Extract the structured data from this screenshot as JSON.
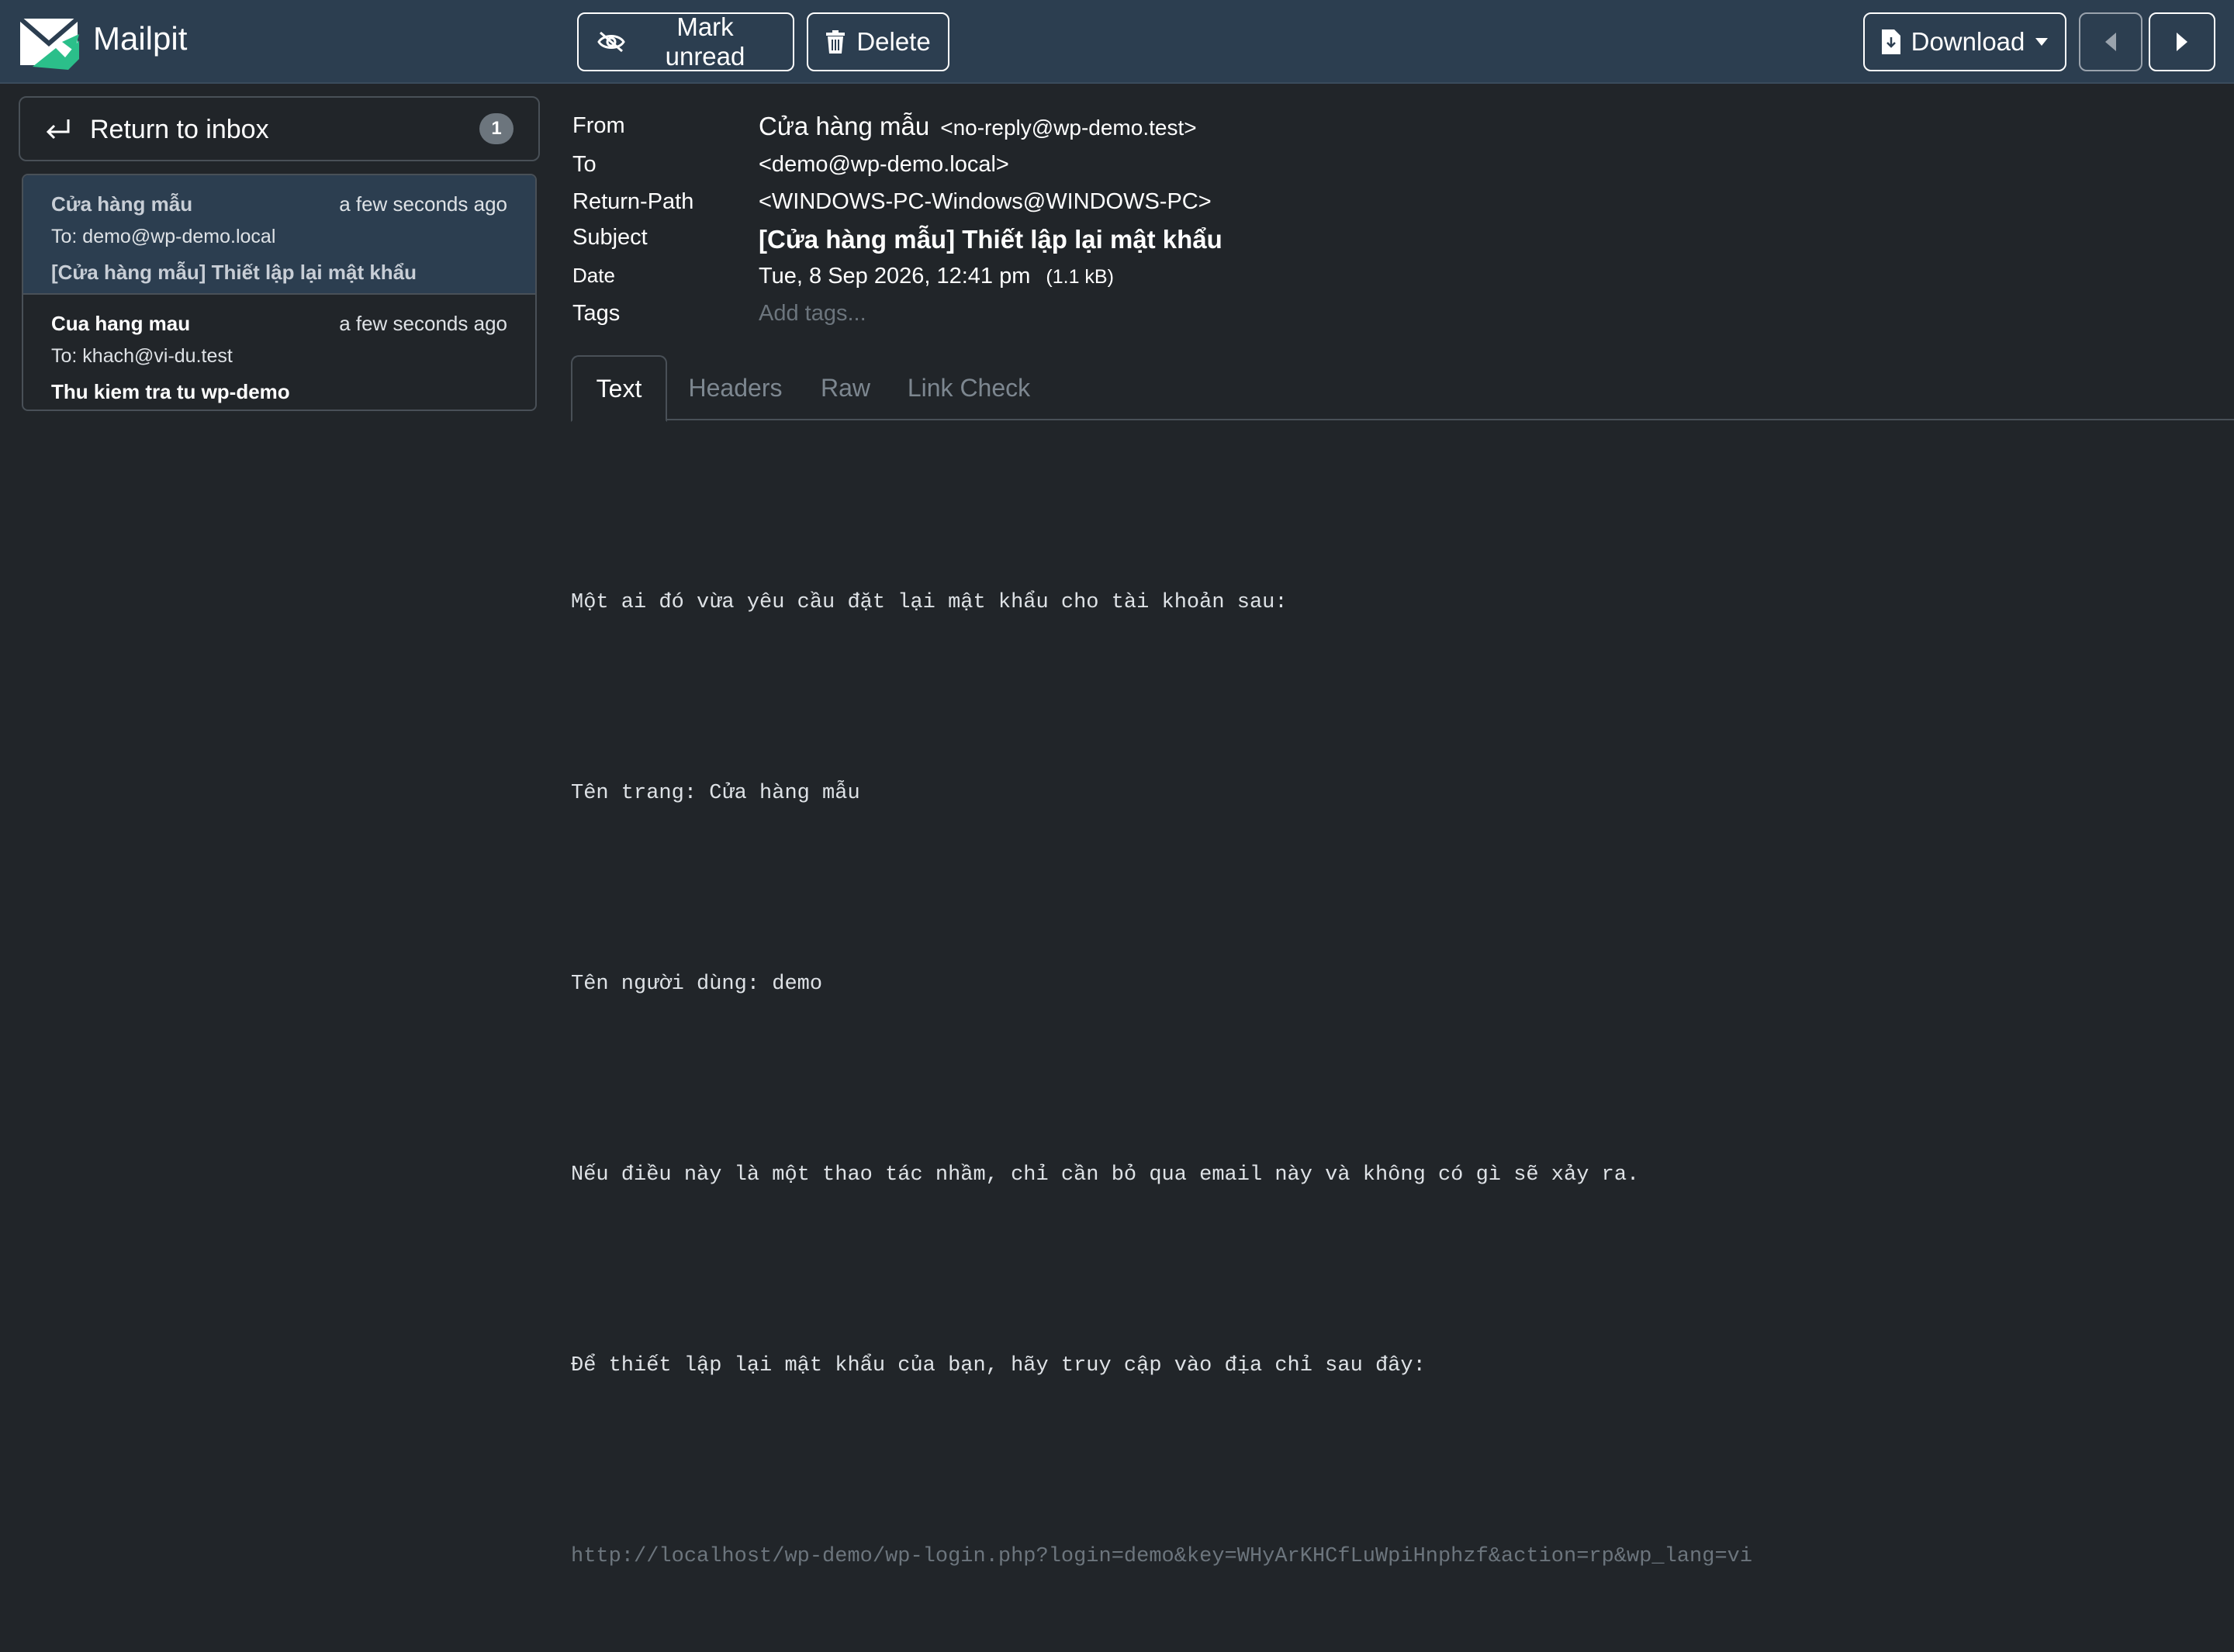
{
  "app": {
    "name": "Mailpit"
  },
  "toolbar": {
    "mark_unread": "Mark unread",
    "delete": "Delete",
    "download": "Download"
  },
  "sidebar": {
    "return_label": "Return to inbox",
    "unread_count": "1",
    "messages": [
      {
        "from": "Cửa hàng mẫu",
        "time": "a few seconds ago",
        "to": "To: demo@wp-demo.local",
        "subject": "[Cửa hàng mẫu] Thiết lập lại mật khẩu",
        "active": true
      },
      {
        "from": "Cua hang mau",
        "time": "a few seconds ago",
        "to": "To: khach@vi-du.test",
        "subject": "Thu kiem tra tu wp-demo",
        "active": false
      }
    ]
  },
  "headers": {
    "from_label": "From",
    "from_name": "Cửa hàng mẫu",
    "from_email": "<no-reply@wp-demo.test>",
    "to_label": "To",
    "to_value": "<demo@wp-demo.local>",
    "return_path_label": "Return-Path",
    "return_path_value": "<WINDOWS-PC-Windows@WINDOWS-PC>",
    "subject_label": "Subject",
    "subject_value": "[Cửa hàng mẫu] Thiết lập lại mật khẩu",
    "date_label": "Date",
    "date_value": "Tue, 8 Sep 2026, 12:41 pm",
    "size_value": "(1.1 kB)",
    "tags_label": "Tags",
    "tags_placeholder": "Add tags..."
  },
  "tabs": [
    {
      "label": "Text",
      "active": true
    },
    {
      "label": "Headers",
      "active": false
    },
    {
      "label": "Raw",
      "active": false
    },
    {
      "label": "Link Check",
      "active": false
    }
  ],
  "body": {
    "line1": "Một ai đó vừa yêu cầu đặt lại mật khẩu cho tài khoản sau:",
    "line2": "Tên trang: Cửa hàng mẫu",
    "line3": "Tên người dùng: demo",
    "line4": "Nếu điều này là một thao tác nhầm, chỉ cần bỏ qua email này và không có gì sẽ xảy ra.",
    "line5": "Để thiết lập lại mật khẩu của bạn, hãy truy cập vào địa chỉ sau đây:",
    "link": "http://localhost/wp-demo/wp-login.php?login=demo&key=WHyArKHCfLuWpiHnphzf&action=rp&wp_lang=vi"
  },
  "colors": {
    "topbar": "#2c3e50",
    "background": "#212529",
    "border": "#495057",
    "muted": "#6c757d",
    "logo_green": "#2bbf8a"
  }
}
